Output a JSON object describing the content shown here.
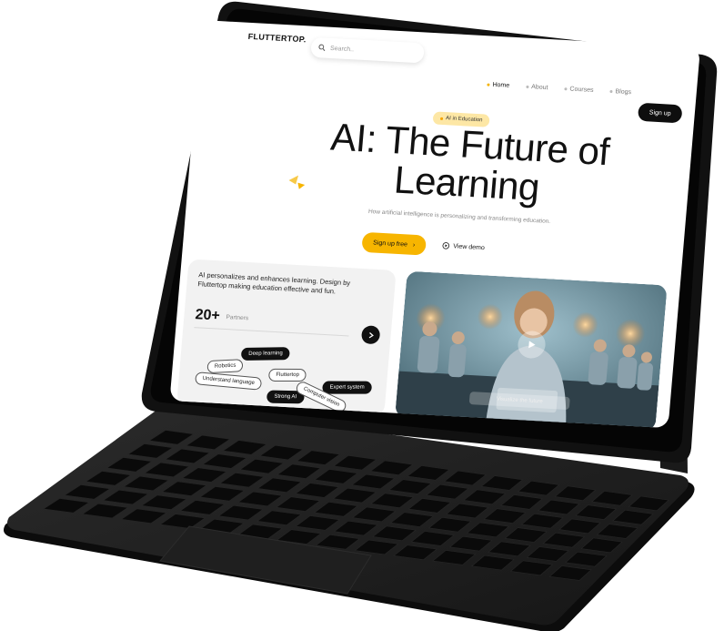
{
  "header": {
    "logo": "FLUTTERTOP.",
    "search_placeholder": "Search..",
    "nav": [
      {
        "label": "Home",
        "active": true
      },
      {
        "label": "About",
        "active": false
      },
      {
        "label": "Courses",
        "active": false
      },
      {
        "label": "Blogs",
        "active": false
      }
    ],
    "signup_label": "Sign up"
  },
  "hero": {
    "badge": "AI in Education",
    "title_line1": "AI: The Future of",
    "title_line2": "Learning",
    "subtitle": "How artificial intelligence is personalizing and transforming education.",
    "cta_label": "Sign up free",
    "demo_label": "View demo"
  },
  "info_card": {
    "text": "AI personalizes and enhances learning. Design by Fluttertop making education effective and fun.",
    "partners_count": "20+",
    "partners_label": "Partners",
    "tags": [
      "Deep learning",
      "Robotics",
      "Fluttertop",
      "Understand language",
      "Expert system",
      "Strong AI",
      "Computer vision"
    ]
  },
  "video": {
    "caption": "Visualize the future"
  },
  "colors": {
    "accent": "#f7b500",
    "dark": "#0e0e0e",
    "device": "#1a1a1a"
  }
}
